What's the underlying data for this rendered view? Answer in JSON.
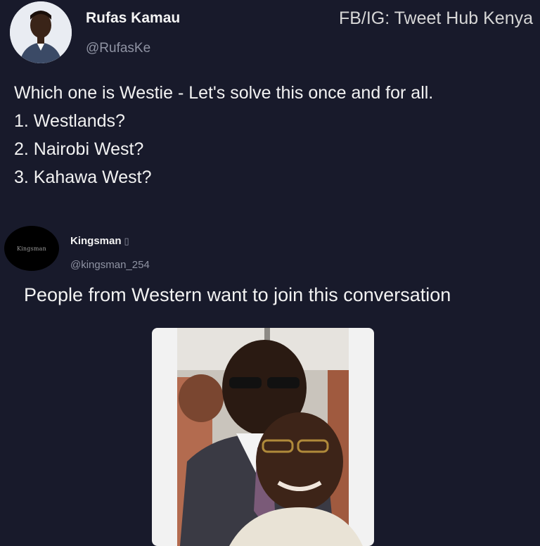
{
  "tweet": {
    "author_name": "Rufas Kamau",
    "author_handle": "@RufasKe",
    "watermark": "FB/IG: Tweet Hub Kenya",
    "lines": [
      "Which one is Westie - Let's solve this once and for all.",
      "1. Westlands?",
      "2. Nairobi West?",
      "3. Kahawa West?"
    ]
  },
  "reply": {
    "author_name": "Kingsman",
    "verified_glyph": "▯",
    "author_handle": "@kingsman_254",
    "avatar_text": "Kingsman",
    "text": "People from Western want to join this conversation"
  },
  "colors": {
    "background": "#181a2b",
    "text": "#f2f2f2",
    "muted": "#8f93a3"
  }
}
